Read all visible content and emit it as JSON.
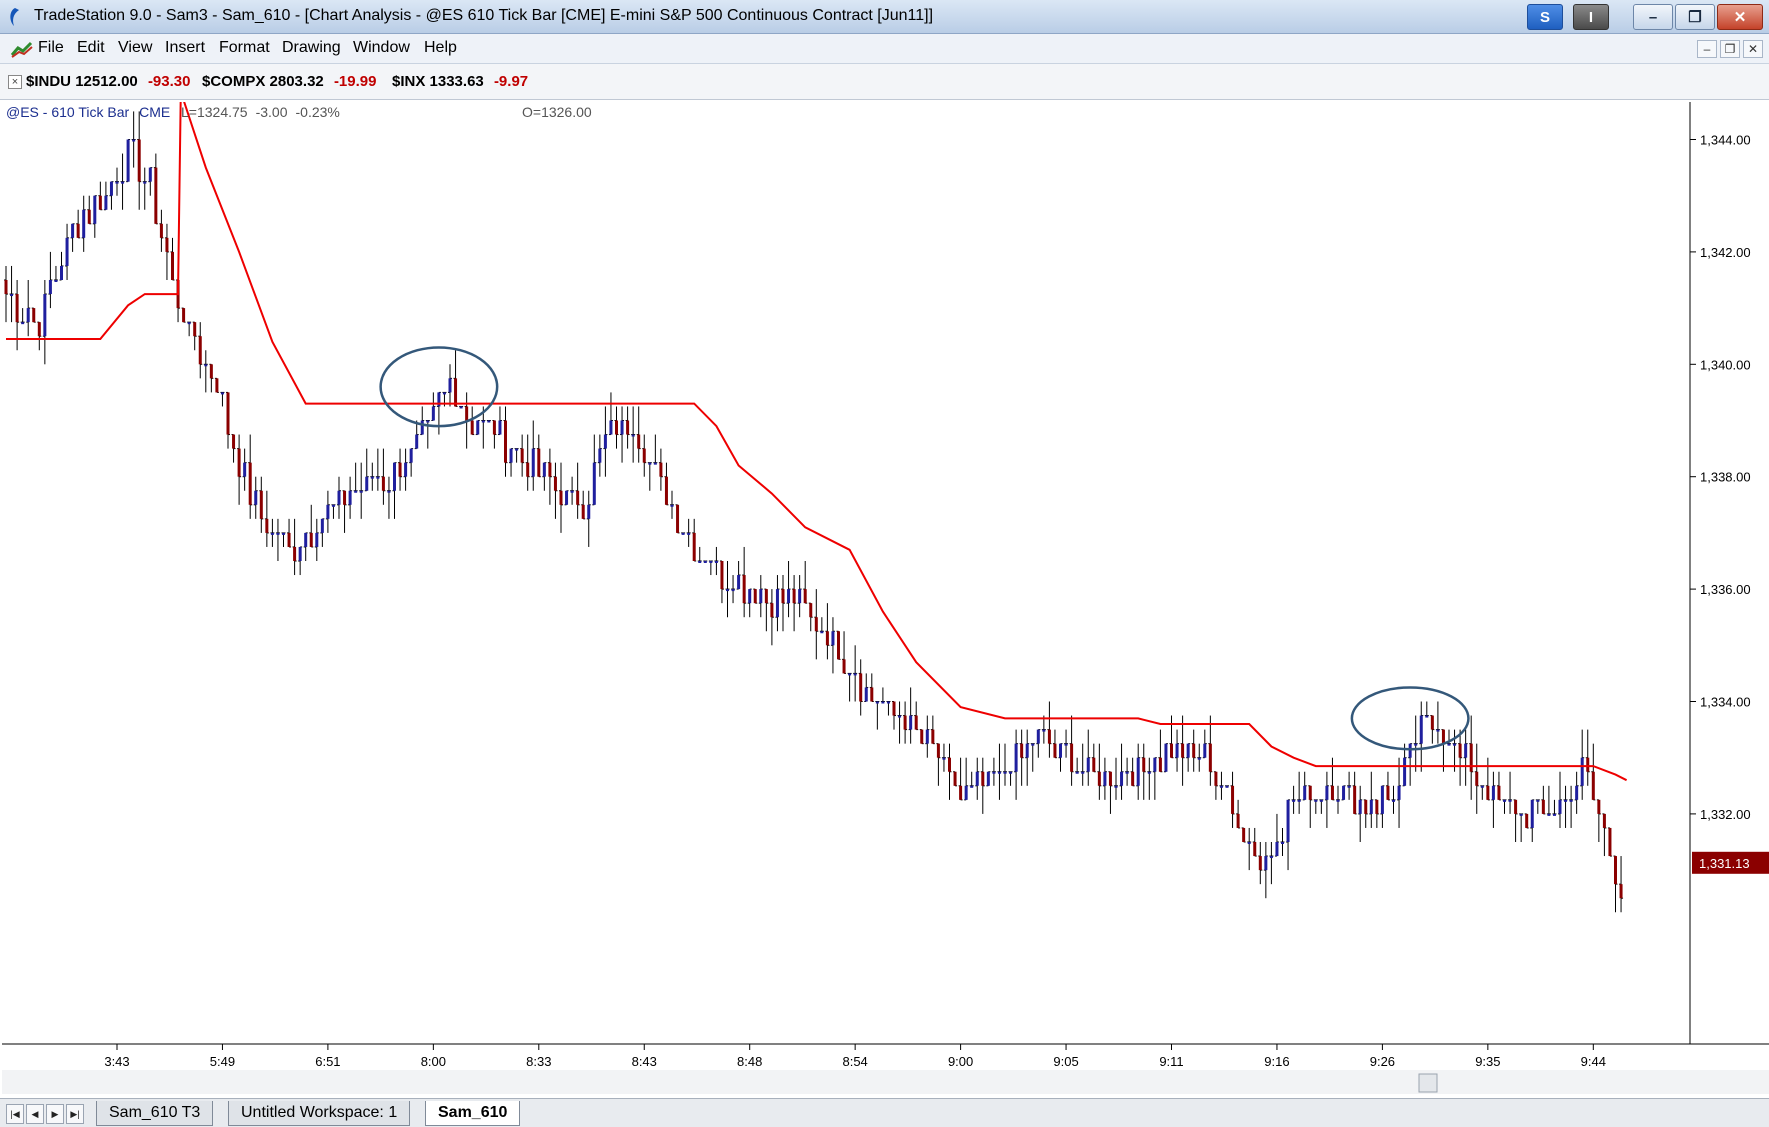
{
  "window": {
    "title": "TradeStation 9.0 - Sam3 - Sam_610 - [Chart Analysis - @ES 610 Tick Bar [CME] E-mini S&P 500 Continuous Contract [Jun11]]",
    "badge_s": "S",
    "badge_i": "I",
    "minimize_glyph": "–",
    "maximize_glyph": "❐",
    "close_glyph": "✕"
  },
  "menu": {
    "items": [
      "File",
      "Edit",
      "View",
      "Insert",
      "Format",
      "Drawing",
      "Window",
      "Help"
    ],
    "mdi_minimize": "–",
    "mdi_restore": "❐",
    "mdi_close": "✕"
  },
  "tickers": [
    {
      "symbol": "$INDU",
      "price": "12512.00",
      "change": "-93.30"
    },
    {
      "symbol": "$COMPX",
      "price": "2803.32",
      "change": "-19.99"
    },
    {
      "symbol": "$INX",
      "price": "1333.63",
      "change": "-9.97"
    }
  ],
  "ticker_close_glyph": "×",
  "chart_header": {
    "symbol": "@ES - 610 Tick Bar",
    "exchange": "CME",
    "last": "L=1324.75",
    "net_change": "-3.00",
    "pct_change": "-0.23%",
    "open": "O=1326.00"
  },
  "colors": {
    "up_bar": "#1f1f9e",
    "down_bar": "#8b0000",
    "tick_bar": "#000000",
    "indicator_line": "#ee0000",
    "ellipse": "#34587a",
    "last_price_badge": "#8b0000"
  },
  "chart_data": {
    "type": "line",
    "description_series": [
      "price_bars",
      "red_indicator"
    ],
    "y_axis_ticks": [
      "1,344.00",
      "1,342.00",
      "1,340.00",
      "1,338.00",
      "1,336.00",
      "1,334.00",
      "1,332.00"
    ],
    "y_tick_values": [
      1344,
      1342,
      1340,
      1338,
      1336,
      1334,
      1332
    ],
    "ylim": [
      1329.87,
      1345.5
    ],
    "x_axis_ticks": [
      "3:43",
      "5:49",
      "6:51",
      "8:00",
      "8:33",
      "8:43",
      "8:48",
      "8:54",
      "9:00",
      "9:05",
      "9:11",
      "9:16",
      "9:26",
      "9:35",
      "9:44"
    ],
    "x_tick_bar_index": [
      20,
      39,
      58,
      77,
      96,
      115,
      134,
      153,
      172,
      191,
      210,
      229,
      248,
      267,
      286
    ],
    "bar_count": 292,
    "last_price_label": "1,331.13",
    "last_price": 1331.13,
    "price_anchors": [
      [
        0,
        1341.2
      ],
      [
        6,
        1340.8
      ],
      [
        12,
        1342.5
      ],
      [
        18,
        1343.0
      ],
      [
        22,
        1343.8
      ],
      [
        26,
        1343.2
      ],
      [
        30,
        1341.5
      ],
      [
        33,
        1340.6
      ],
      [
        38,
        1339.7
      ],
      [
        42,
        1338.2
      ],
      [
        46,
        1337.2
      ],
      [
        52,
        1336.7
      ],
      [
        58,
        1337.4
      ],
      [
        64,
        1337.9
      ],
      [
        70,
        1338.0
      ],
      [
        75,
        1338.7
      ],
      [
        80,
        1339.6
      ],
      [
        84,
        1339.0
      ],
      [
        89,
        1338.7
      ],
      [
        94,
        1338.3
      ],
      [
        100,
        1337.7
      ],
      [
        104,
        1337.5
      ],
      [
        109,
        1338.8
      ],
      [
        113,
        1338.9
      ],
      [
        118,
        1337.9
      ],
      [
        124,
        1336.8
      ],
      [
        130,
        1336.2
      ],
      [
        136,
        1335.9
      ],
      [
        142,
        1335.8
      ],
      [
        146,
        1335.4
      ],
      [
        152,
        1334.6
      ],
      [
        158,
        1333.9
      ],
      [
        164,
        1333.5
      ],
      [
        172,
        1332.3
      ],
      [
        178,
        1332.6
      ],
      [
        186,
        1333.3
      ],
      [
        192,
        1333.0
      ],
      [
        197,
        1332.6
      ],
      [
        204,
        1332.8
      ],
      [
        210,
        1333.1
      ],
      [
        216,
        1333.0
      ],
      [
        222,
        1331.9
      ],
      [
        226,
        1331.1
      ],
      [
        232,
        1332.2
      ],
      [
        238,
        1332.5
      ],
      [
        244,
        1332.2
      ],
      [
        250,
        1332.3
      ],
      [
        254,
        1333.3
      ],
      [
        258,
        1333.7
      ],
      [
        262,
        1333.0
      ],
      [
        268,
        1332.3
      ],
      [
        274,
        1332.0
      ],
      [
        280,
        1332.1
      ],
      [
        284,
        1332.8
      ],
      [
        288,
        1331.8
      ],
      [
        291,
        1330.6
      ]
    ],
    "red_indicator": [
      [
        0,
        1340.45
      ],
      [
        17,
        1340.45
      ],
      [
        22,
        1341.05
      ],
      [
        25,
        1341.25
      ],
      [
        31,
        1341.25
      ],
      [
        31.5,
        1344.85
      ],
      [
        36,
        1343.5
      ],
      [
        42,
        1342.0
      ],
      [
        48,
        1340.4
      ],
      [
        54,
        1339.3
      ],
      [
        124,
        1339.3
      ],
      [
        128,
        1338.9
      ],
      [
        132,
        1338.2
      ],
      [
        138,
        1337.7
      ],
      [
        144,
        1337.1
      ],
      [
        152,
        1336.7
      ],
      [
        158,
        1335.6
      ],
      [
        164,
        1334.7
      ],
      [
        172,
        1333.9
      ],
      [
        180,
        1333.7
      ],
      [
        204,
        1333.7
      ],
      [
        208,
        1333.6
      ],
      [
        224,
        1333.6
      ],
      [
        228,
        1333.2
      ],
      [
        232,
        1333.0
      ],
      [
        236,
        1332.85
      ],
      [
        258,
        1332.85
      ],
      [
        272,
        1332.85
      ],
      [
        286,
        1332.85
      ],
      [
        290,
        1332.7
      ],
      [
        292,
        1332.6
      ]
    ],
    "annotations": [
      {
        "type": "ellipse",
        "center_bar_index": 78,
        "center_price": 1339.6,
        "width_bars": 21,
        "height_price": 1.4
      },
      {
        "type": "ellipse",
        "center_bar_index": 253,
        "center_price": 1333.7,
        "width_bars": 21,
        "height_price": 1.1
      }
    ]
  },
  "tabs": {
    "nav": [
      "|◀",
      "◀",
      "▶",
      "▶|"
    ],
    "items": [
      "Sam_610 T3",
      "Untitled Workspace:  1",
      "Sam_610"
    ]
  }
}
